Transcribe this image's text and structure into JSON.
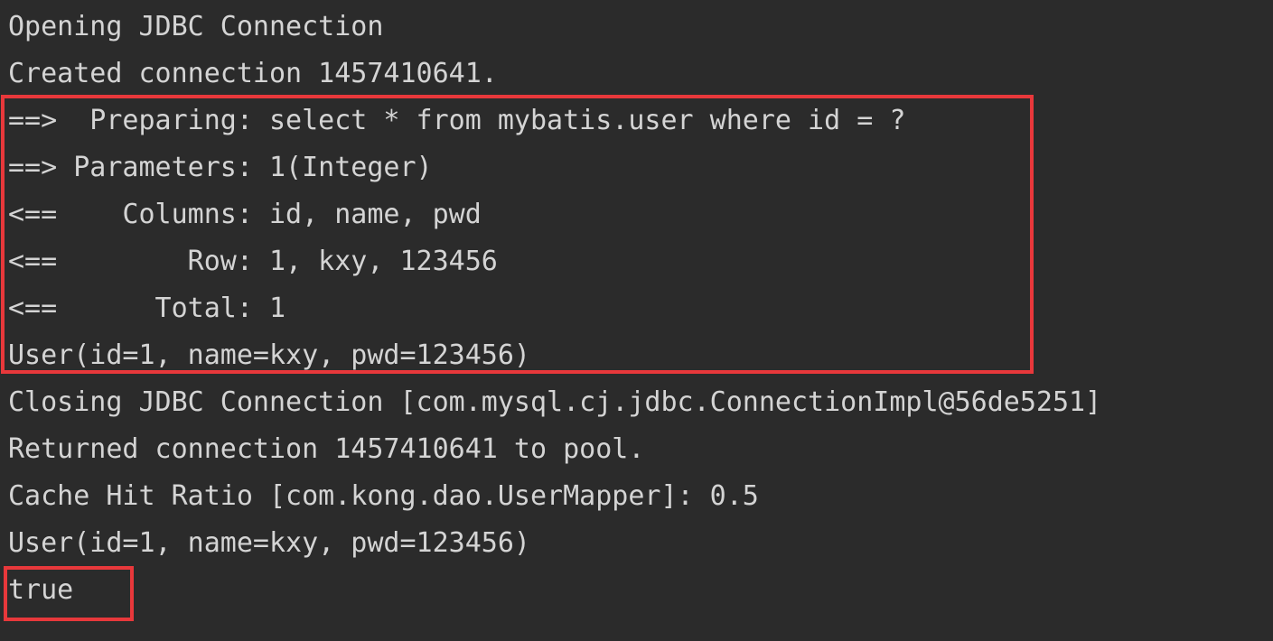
{
  "console": {
    "lines": [
      "Opening JDBC Connection",
      "Created connection 1457410641.",
      "==>  Preparing: select * from mybatis.user where id = ?",
      "==> Parameters: 1(Integer)",
      "<==    Columns: id, name, pwd",
      "<==        Row: 1, kxy, 123456",
      "<==      Total: 1",
      "User(id=1, name=kxy, pwd=123456)",
      "Closing JDBC Connection [com.mysql.cj.jdbc.ConnectionImpl@56de5251]",
      "Returned connection 1457410641 to pool.",
      "Cache Hit Ratio [com.kong.dao.UserMapper]: 0.5",
      "User(id=1, name=kxy, pwd=123456)",
      "true"
    ]
  },
  "colors": {
    "background": "#2b2b2b",
    "text": "#d4d4d4",
    "highlight_border": "#e8383b"
  }
}
